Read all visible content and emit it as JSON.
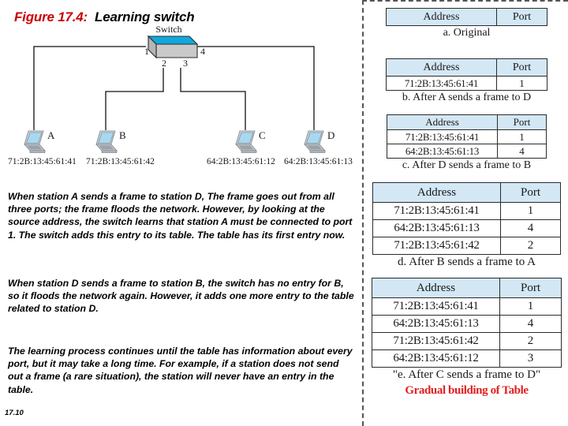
{
  "figure": {
    "number": "Figure 17.4:",
    "name": "Learning switch"
  },
  "diagram": {
    "switch_label": "Switch",
    "port_labels": [
      "1",
      "2",
      "3",
      "4"
    ],
    "stations": [
      {
        "name": "A",
        "mac": "71:2B:13:45:61:41",
        "port": "1"
      },
      {
        "name": "B",
        "mac": "71:2B:13:45:61:42",
        "port": "2"
      },
      {
        "name": "C",
        "mac": "64:2B:13:45:61:12",
        "port": "3"
      },
      {
        "name": "D",
        "mac": "64:2B:13:45:61:13",
        "port": "4"
      }
    ],
    "switch_top_color": "#11a8dd",
    "switch_body_color": "#c9c9c9",
    "laptop_screen_color": "#a8d8ef"
  },
  "body": {
    "paragraph_1": "When station A sends a frame to station D, The frame goes out from all three ports; the frame floods the network. However, by looking at the source address, the switch learns that station A must be connected to port 1. The switch adds this entry to its table. The table has its first entry now.",
    "paragraph_2": "When station D sends a frame to station B, the switch has no entry for B, so it floods the network again. However, it adds one more entry to the table related to station D.",
    "paragraph_3": "The learning process continues until the table has information about every port, but it may take a long time. For example, if a station does not send out a frame (a rare situation), the station will never have an entry in the table."
  },
  "slide_number": "17.10",
  "tables": {
    "headers": [
      "Address",
      "Port"
    ],
    "stages": [
      {
        "id": "a",
        "caption": "a. Original",
        "rows": []
      },
      {
        "id": "b",
        "caption": "b. After A sends a frame to D",
        "rows": [
          {
            "address": "71:2B:13:45:61:41",
            "port": "1"
          }
        ]
      },
      {
        "id": "c",
        "caption": "c. After D sends a frame to B",
        "rows": [
          {
            "address": "71:2B:13:45:61:41",
            "port": "1"
          },
          {
            "address": "64:2B:13:45:61:13",
            "port": "4"
          }
        ]
      },
      {
        "id": "d",
        "caption": "d. After B sends a frame to A",
        "rows": [
          {
            "address": "71:2B:13:45:61:41",
            "port": "1"
          },
          {
            "address": "64:2B:13:45:61:13",
            "port": "4"
          },
          {
            "address": "71:2B:13:45:61:42",
            "port": "2"
          }
        ]
      },
      {
        "id": "e",
        "caption": "\"e. After C sends a frame to D\"",
        "rows": [
          {
            "address": "71:2B:13:45:61:41",
            "port": "1"
          },
          {
            "address": "64:2B:13:45:61:13",
            "port": "4"
          },
          {
            "address": "71:2B:13:45:61:42",
            "port": "2"
          },
          {
            "address": "64:2B:13:45:61:12",
            "port": "3"
          }
        ]
      }
    ],
    "footer_label": "Gradual building of Table",
    "header_fill": "#d3e7f4",
    "footer_color": "#e02020"
  }
}
